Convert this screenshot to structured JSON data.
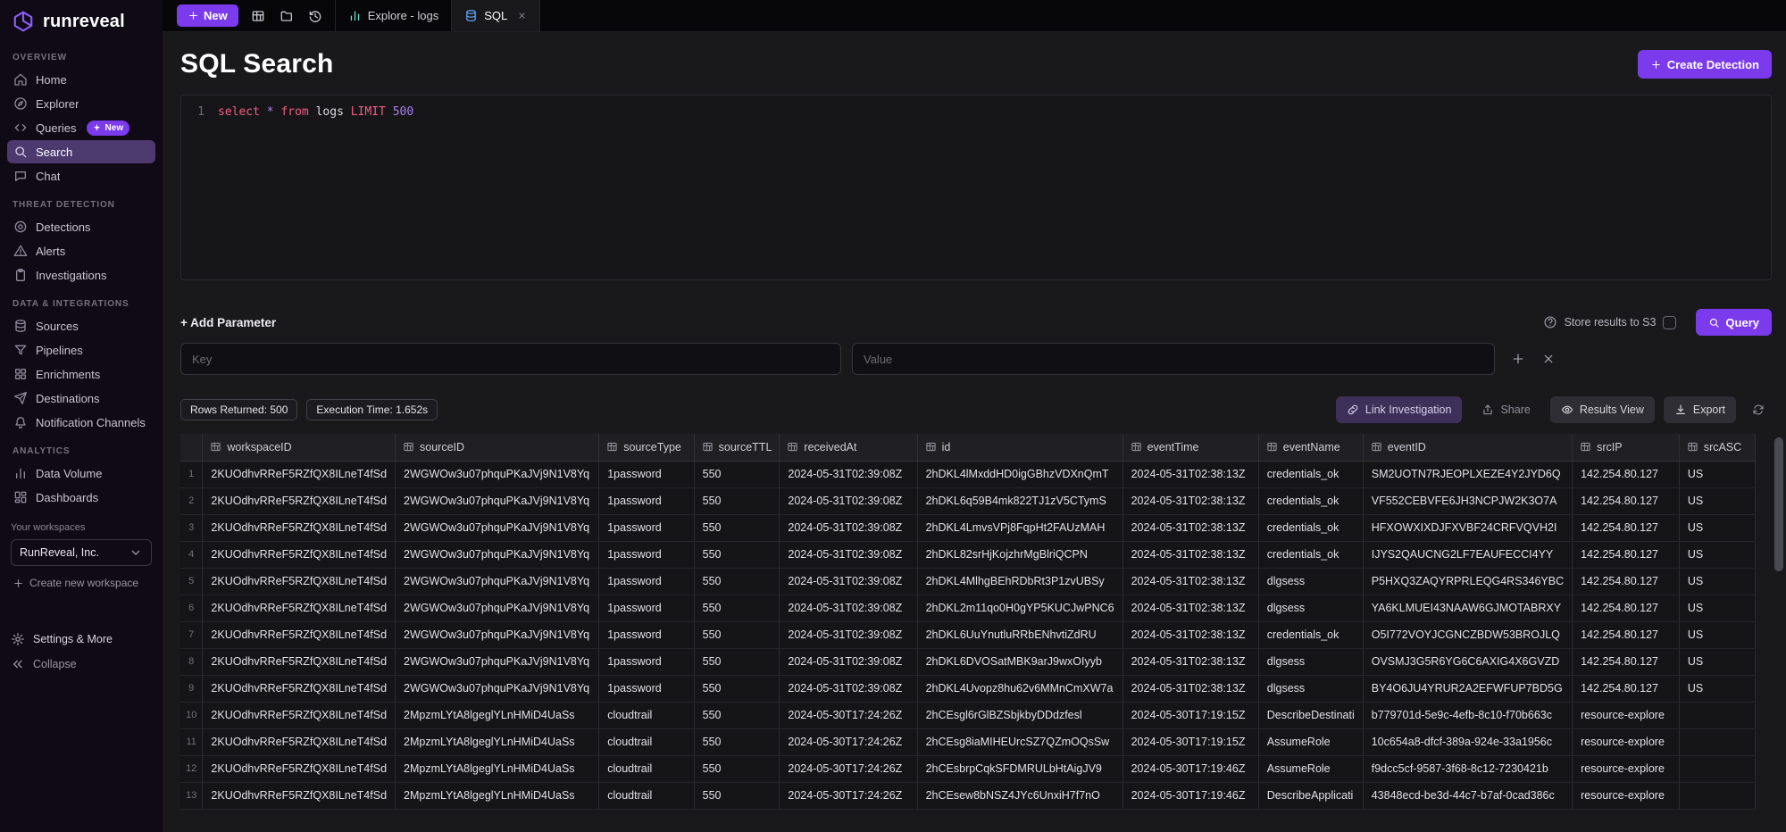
{
  "brand": {
    "name": "runreveal"
  },
  "topbar": {
    "new_button": "New",
    "tabs": [
      {
        "label": "Explore - logs",
        "icon": "chart",
        "active": false,
        "closable": false
      },
      {
        "label": "SQL",
        "icon": "database-blue",
        "active": true,
        "closable": true
      }
    ]
  },
  "sidebar": {
    "sections": [
      {
        "label": "OVERVIEW",
        "items": [
          {
            "label": "Home",
            "icon": "home"
          },
          {
            "label": "Explorer",
            "icon": "compass"
          },
          {
            "label": "Queries",
            "icon": "code",
            "badge": "New"
          },
          {
            "label": "Search",
            "icon": "search",
            "active": true
          },
          {
            "label": "Chat",
            "icon": "chat"
          }
        ]
      },
      {
        "label": "THREAT DETECTION",
        "items": [
          {
            "label": "Detections",
            "icon": "target"
          },
          {
            "label": "Alerts",
            "icon": "warning"
          },
          {
            "label": "Investigations",
            "icon": "clipboard"
          }
        ]
      },
      {
        "label": "DATA & INTEGRATIONS",
        "items": [
          {
            "label": "Sources",
            "icon": "database"
          },
          {
            "label": "Pipelines",
            "icon": "funnel"
          },
          {
            "label": "Enrichments",
            "icon": "grid4"
          },
          {
            "label": "Destinations",
            "icon": "send"
          },
          {
            "label": "Notification Channels",
            "icon": "bell"
          }
        ]
      },
      {
        "label": "ANALYTICS",
        "items": [
          {
            "label": "Data Volume",
            "icon": "barchart"
          },
          {
            "label": "Dashboards",
            "icon": "dashboard"
          }
        ]
      }
    ],
    "workspaces_label": "Your workspaces",
    "workspace_selected": "RunReveal, Inc.",
    "create_workspace": "Create new workspace",
    "settings": "Settings & More",
    "collapse": "Collapse"
  },
  "page": {
    "title": "SQL Search",
    "create_detection": "Create Detection"
  },
  "editor": {
    "line_number": "1",
    "tokens": [
      {
        "text": "select",
        "type": "keyword"
      },
      {
        "text": "*",
        "type": "operator"
      },
      {
        "text": "from",
        "type": "keyword"
      },
      {
        "text": "logs",
        "type": "plain"
      },
      {
        "text": "LIMIT",
        "type": "keyword"
      },
      {
        "text": "500",
        "type": "number"
      }
    ]
  },
  "params": {
    "add_parameter": "+ Add Parameter",
    "key_placeholder": "Key",
    "value_placeholder": "Value",
    "store_results_label": "Store results to S3",
    "query_button": "Query"
  },
  "results": {
    "badges": [
      "Rows Returned: 500",
      "Execution Time: 1.652s"
    ],
    "link_investigation": "Link Investigation",
    "share": "Share",
    "results_view": "Results View",
    "export": "Export"
  },
  "table": {
    "columns": [
      "workspaceID",
      "sourceID",
      "sourceType",
      "sourceTTL",
      "receivedAt",
      "id",
      "eventTime",
      "eventName",
      "eventID",
      "srcIP",
      "srcASC"
    ],
    "rows": [
      [
        "2KUOdhvRReF5RZfQX8ILneT4fSd",
        "2WGWOw3u07phquPKaJVj9N1V8Yq",
        "1password",
        "550",
        "2024-05-31T02:39:08Z",
        "2hDKL4lMxddHD0igGBhzVDXnQmT",
        "2024-05-31T02:38:13Z",
        "credentials_ok",
        "SM2UOTN7RJEOPLXEZE4Y2JYD6Q",
        "142.254.80.127",
        "US"
      ],
      [
        "2KUOdhvRReF5RZfQX8ILneT4fSd",
        "2WGWOw3u07phquPKaJVj9N1V8Yq",
        "1password",
        "550",
        "2024-05-31T02:39:08Z",
        "2hDKL6q59B4mk822TJ1zV5CTymS",
        "2024-05-31T02:38:13Z",
        "credentials_ok",
        "VF552CEBVFE6JH3NCPJW2K3O7A",
        "142.254.80.127",
        "US"
      ],
      [
        "2KUOdhvRReF5RZfQX8ILneT4fSd",
        "2WGWOw3u07phquPKaJVj9N1V8Yq",
        "1password",
        "550",
        "2024-05-31T02:39:08Z",
        "2hDKL4LmvsVPj8FqpHt2FAUzMAH",
        "2024-05-31T02:38:13Z",
        "credentials_ok",
        "HFXOWXIXDJFXVBF24CRFVQVH2I",
        "142.254.80.127",
        "US"
      ],
      [
        "2KUOdhvRReF5RZfQX8ILneT4fSd",
        "2WGWOw3u07phquPKaJVj9N1V8Yq",
        "1password",
        "550",
        "2024-05-31T02:39:08Z",
        "2hDKL82srHjKojzhrMgBlriQCPN",
        "2024-05-31T02:38:13Z",
        "credentials_ok",
        "IJYS2QAUCNG2LF7EAUFECCI4YY",
        "142.254.80.127",
        "US"
      ],
      [
        "2KUOdhvRReF5RZfQX8ILneT4fSd",
        "2WGWOw3u07phquPKaJVj9N1V8Yq",
        "1password",
        "550",
        "2024-05-31T02:39:08Z",
        "2hDKL4MlhgBEhRDbRt3P1zvUBSy",
        "2024-05-31T02:38:13Z",
        "dlgsess",
        "P5HXQ3ZAQYRPRLEQG4RS346YBC",
        "142.254.80.127",
        "US"
      ],
      [
        "2KUOdhvRReF5RZfQX8ILneT4fSd",
        "2WGWOw3u07phquPKaJVj9N1V8Yq",
        "1password",
        "550",
        "2024-05-31T02:39:08Z",
        "2hDKL2m11qo0H0gYP5KUCJwPNC6",
        "2024-05-31T02:38:13Z",
        "dlgsess",
        "YA6KLMUEI43NAAW6GJMOTABRXY",
        "142.254.80.127",
        "US"
      ],
      [
        "2KUOdhvRReF5RZfQX8ILneT4fSd",
        "2WGWOw3u07phquPKaJVj9N1V8Yq",
        "1password",
        "550",
        "2024-05-31T02:39:08Z",
        "2hDKL6UuYnutluRRbENhvtiZdRU",
        "2024-05-31T02:38:13Z",
        "credentials_ok",
        "O5I772VOYJCGNCZBDW53BROJLQ",
        "142.254.80.127",
        "US"
      ],
      [
        "2KUOdhvRReF5RZfQX8ILneT4fSd",
        "2WGWOw3u07phquPKaJVj9N1V8Yq",
        "1password",
        "550",
        "2024-05-31T02:39:08Z",
        "2hDKL6DVOSatMBK9arJ9wxOIyyb",
        "2024-05-31T02:38:13Z",
        "dlgsess",
        "OVSMJ3G5R6YG6C6AXIG4X6GVZD",
        "142.254.80.127",
        "US"
      ],
      [
        "2KUOdhvRReF5RZfQX8ILneT4fSd",
        "2WGWOw3u07phquPKaJVj9N1V8Yq",
        "1password",
        "550",
        "2024-05-31T02:39:08Z",
        "2hDKL4Uvopz8hu62v6MMnCmXW7a",
        "2024-05-31T02:38:13Z",
        "dlgsess",
        "BY4O6JU4YRUR2A2EFWFUP7BD5G",
        "142.254.80.127",
        "US"
      ],
      [
        "2KUOdhvRReF5RZfQX8ILneT4fSd",
        "2MpzmLYtA8lgeglYLnHMiD4UaSs",
        "cloudtrail",
        "550",
        "2024-05-30T17:24:26Z",
        "2hCEsgl6rGlBZSbjkbyDDdzfesl",
        "2024-05-30T17:19:15Z",
        "DescribeDestinati",
        "b779701d-5e9c-4efb-8c10-f70b663c",
        "resource-explore",
        ""
      ],
      [
        "2KUOdhvRReF5RZfQX8ILneT4fSd",
        "2MpzmLYtA8lgeglYLnHMiD4UaSs",
        "cloudtrail",
        "550",
        "2024-05-30T17:24:26Z",
        "2hCEsg8iaMIHEUrcSZ7QZmOQsSw",
        "2024-05-30T17:19:15Z",
        "AssumeRole",
        "10c654a8-dfcf-389a-924e-33a1956c",
        "resource-explore",
        ""
      ],
      [
        "2KUOdhvRReF5RZfQX8ILneT4fSd",
        "2MpzmLYtA8lgeglYLnHMiD4UaSs",
        "cloudtrail",
        "550",
        "2024-05-30T17:24:26Z",
        "2hCEsbrpCqkSFDMRULbHtAigJV9",
        "2024-05-30T17:19:46Z",
        "AssumeRole",
        "f9dcc5cf-9587-3f68-8c12-7230421b",
        "resource-explore",
        ""
      ],
      [
        "2KUOdhvRReF5RZfQX8ILneT4fSd",
        "2MpzmLYtA8lgeglYLnHMiD4UaSs",
        "cloudtrail",
        "550",
        "2024-05-30T17:24:26Z",
        "2hCEsew8bNSZ4JYc6UnxiH7f7nO",
        "2024-05-30T17:19:46Z",
        "DescribeApplicati",
        "43848ecd-be3d-44c7-b7af-0cad386c",
        "resource-explore",
        ""
      ]
    ]
  },
  "colors": {
    "accent_purple": "#7c3aed",
    "sidebar_active": "#4c3a6e",
    "sql_keyword": "#f25c82",
    "sql_literal": "#a87ff0",
    "tab_sql_icon": "#60a5fa",
    "tab_explore_icon": "#5eead4"
  }
}
